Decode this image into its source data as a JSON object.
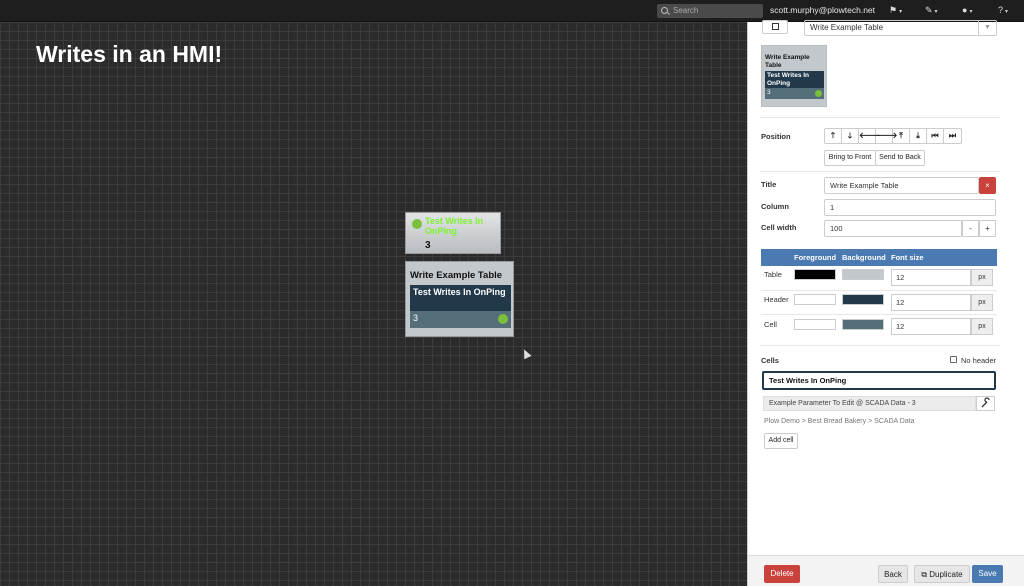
{
  "topbar": {
    "search_placeholder": "Search",
    "user_email": "scott.murphy@plowtech.net",
    "icons": [
      "bookmark-icon",
      "wrench-icon",
      "user-icon",
      "help-icon"
    ]
  },
  "canvas": {
    "title": "Writes in an HMI!",
    "writes_widget": {
      "title": "Test Writes In OnPing",
      "value": "3"
    },
    "table_widget": {
      "title": "Write Example Table",
      "header": "Test Writes In OnPing",
      "cell_value": "3"
    }
  },
  "panel": {
    "type_select": "Write Example Table",
    "thumb": {
      "title": "Write Example Table",
      "header": "Test Writes In OnPing",
      "value": "3"
    },
    "position_label": "Position",
    "arrows": [
      "🡑",
      "🡓",
      "🡐",
      "🡒",
      "⤒",
      "⤓",
      "⏮",
      "⏭"
    ],
    "bring_front": "Bring to Front",
    "send_back": "Send to Back",
    "title_label": "Title",
    "title_value": "Write Example Table",
    "column_label": "Column",
    "column_value": "1",
    "cell_width_label": "Cell width",
    "cell_width_value": "100",
    "minus": "-",
    "plus": "+",
    "clear": "×",
    "styles": {
      "headers": [
        "Foreground",
        "Background",
        "Font size"
      ],
      "rows": [
        {
          "label": "Table",
          "fg": "#000000",
          "bg": "#c3c8cc",
          "size": "12",
          "unit": "px"
        },
        {
          "label": "Header",
          "fg": "#ffffff",
          "bg": "#22394b",
          "size": "12",
          "unit": "px"
        },
        {
          "label": "Cell",
          "fg": "#ffffff",
          "bg": "#546e7a",
          "size": "12",
          "unit": "px"
        }
      ]
    },
    "cells_label": "Cells",
    "no_header_label": "No header",
    "cell_active": "Test Writes In OnPing",
    "param": "Example Parameter To Edit @ SCADA Data - 3",
    "path": "Plow Demo > Best Bread Bakery > SCADA Data",
    "add_cell": "Add cell",
    "footer": {
      "delete": "Delete",
      "back": "Back",
      "duplicate": "Duplicate",
      "save": "Save"
    }
  }
}
